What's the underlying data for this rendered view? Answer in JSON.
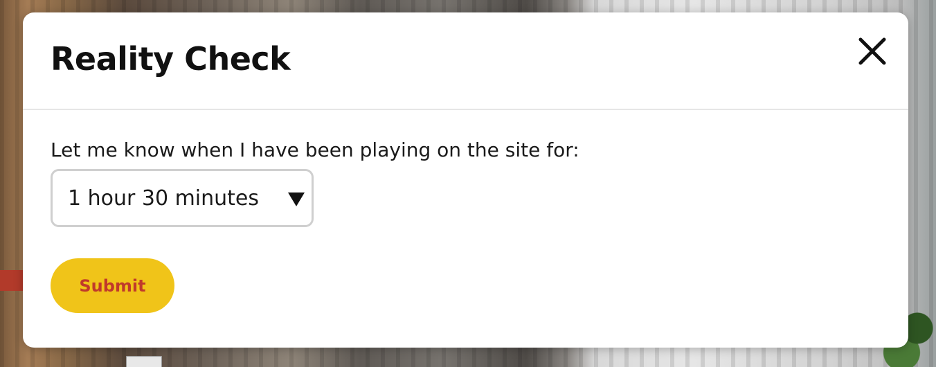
{
  "modal": {
    "title": "Reality Check",
    "close_icon": "close-icon",
    "prompt": "Let me know when I have been playing on the site for:",
    "select": {
      "selected_value": "1 hour 30 minutes",
      "arrow_icon": "triangle-down-icon"
    },
    "submit_label": "Submit"
  },
  "colors": {
    "submit_background": "#f0c419",
    "submit_text": "#c0392b",
    "title_text": "#111111"
  }
}
